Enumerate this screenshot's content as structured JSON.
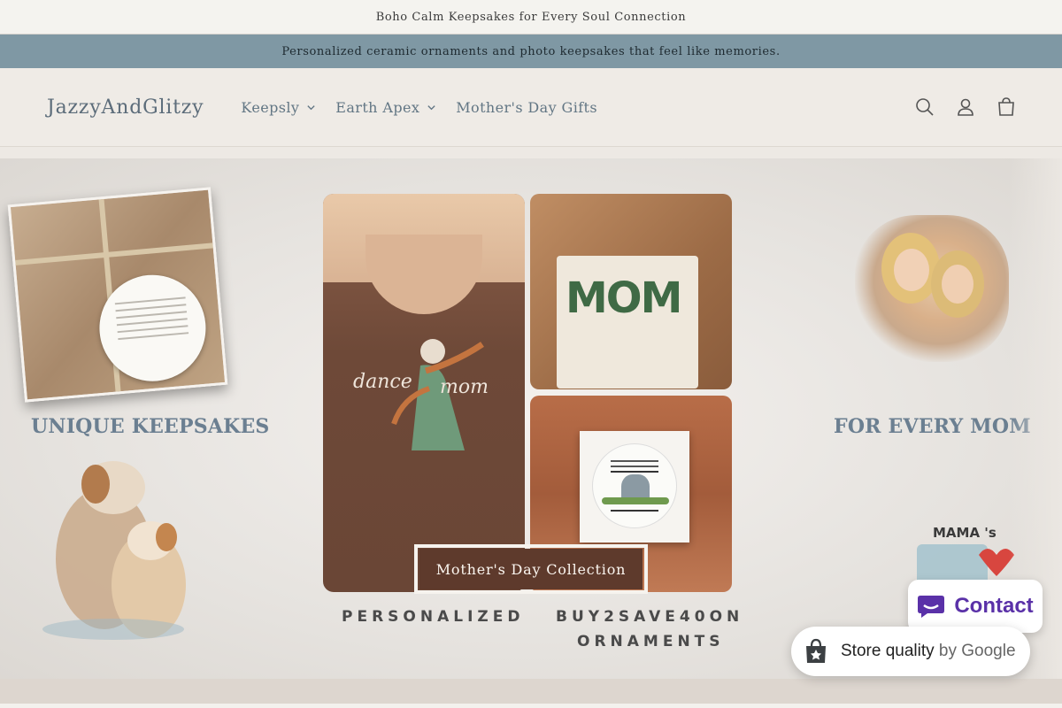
{
  "announcements": {
    "top": "Boho Calm Keepsakes for Every Soul Connection",
    "bar": "Personalized ceramic ornaments and photo keepsakes that feel like memories."
  },
  "header": {
    "logo": "JazzyAndGlitzy",
    "nav": [
      {
        "label": "Keepsly",
        "has_dropdown": true
      },
      {
        "label": "Earth Apex",
        "has_dropdown": true
      },
      {
        "label": "Mother's Day Gifts",
        "has_dropdown": false
      }
    ],
    "icons": [
      "search-icon",
      "account-icon",
      "cart-icon"
    ]
  },
  "hero": {
    "left_headline": "UNIQUE KEEPSAKES",
    "right_headline": "FOR EVERY MOM",
    "cta_label": "Mother's Day Collection",
    "caption_left": "PERSONALIZED",
    "caption_right_line1": "BUY2SAVE40ON",
    "caption_right_line2": "ORNAMENTS",
    "shirt_text_1": "dance",
    "shirt_text_2": "mom",
    "tote_text": "MOM",
    "mama_text": "MAMA 's"
  },
  "widgets": {
    "contact_label": "Contact",
    "quality_label": "Store quality",
    "quality_by": "by Google"
  },
  "colors": {
    "announcement_bar": "#7f98a4",
    "header_bg": "#efebe6",
    "headline": "#6b7f91",
    "cta_bg": "#5e3a2c",
    "contact_accent": "#5a31a8"
  }
}
